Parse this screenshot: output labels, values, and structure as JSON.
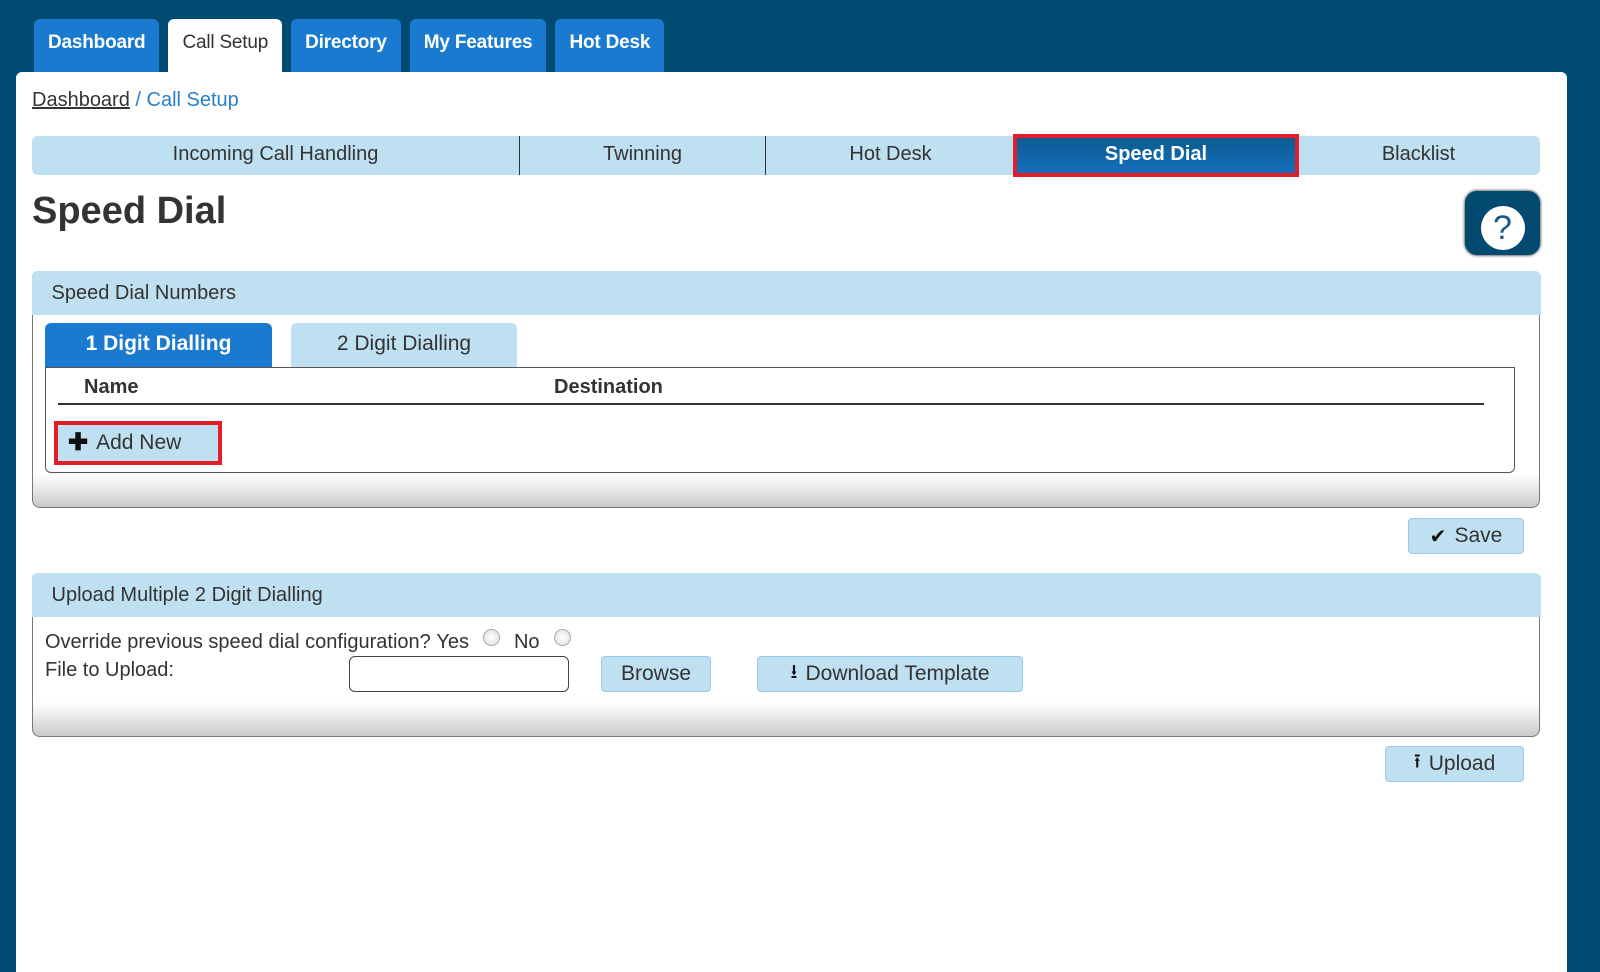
{
  "top_nav": {
    "tabs": [
      {
        "label": "Dashboard",
        "active": false
      },
      {
        "label": "Call Setup",
        "active": true
      },
      {
        "label": "Directory",
        "active": false
      },
      {
        "label": "My Features",
        "active": false
      },
      {
        "label": "Hot Desk",
        "active": false
      }
    ]
  },
  "breadcrumb": {
    "link": "Dashboard",
    "separator": "/",
    "current": "Call Setup"
  },
  "sub_tabs": [
    {
      "label": "Incoming Call Handling",
      "active": false
    },
    {
      "label": "Twinning",
      "active": false
    },
    {
      "label": "Hot Desk",
      "active": false
    },
    {
      "label": "Speed Dial",
      "active": true
    },
    {
      "label": "Blacklist",
      "active": false
    }
  ],
  "page_title": "Speed Dial",
  "help": {
    "icon": "question-icon",
    "glyph": "?"
  },
  "speed_dial_numbers": {
    "title": "Speed Dial Numbers",
    "tabs": [
      {
        "label": "1 Digit Dialling",
        "active": true
      },
      {
        "label": "2 Digit Dialling",
        "active": false
      }
    ],
    "columns": [
      "Name",
      "Destination"
    ],
    "rows": [],
    "add_new_label": "Add New",
    "add_new_icon": "✚"
  },
  "save": {
    "label": "Save",
    "icon": "✔"
  },
  "upload_section": {
    "title": "Upload Multiple 2 Digit Dialling",
    "override_question": "Override previous speed dial configuration?",
    "yes_label": "Yes",
    "no_label": "No",
    "file_label": "File to Upload:",
    "file_value": "",
    "browse_label": "Browse",
    "download_label": "Download Template",
    "download_icon": "⭳"
  },
  "upload": {
    "label": "Upload",
    "icon": "⭱"
  },
  "colors": {
    "brand_dark": "#004b71",
    "tab_blue": "#1a7ad0",
    "light_blue": "#bfe0f1",
    "highlight_red": "#e31e2b"
  }
}
